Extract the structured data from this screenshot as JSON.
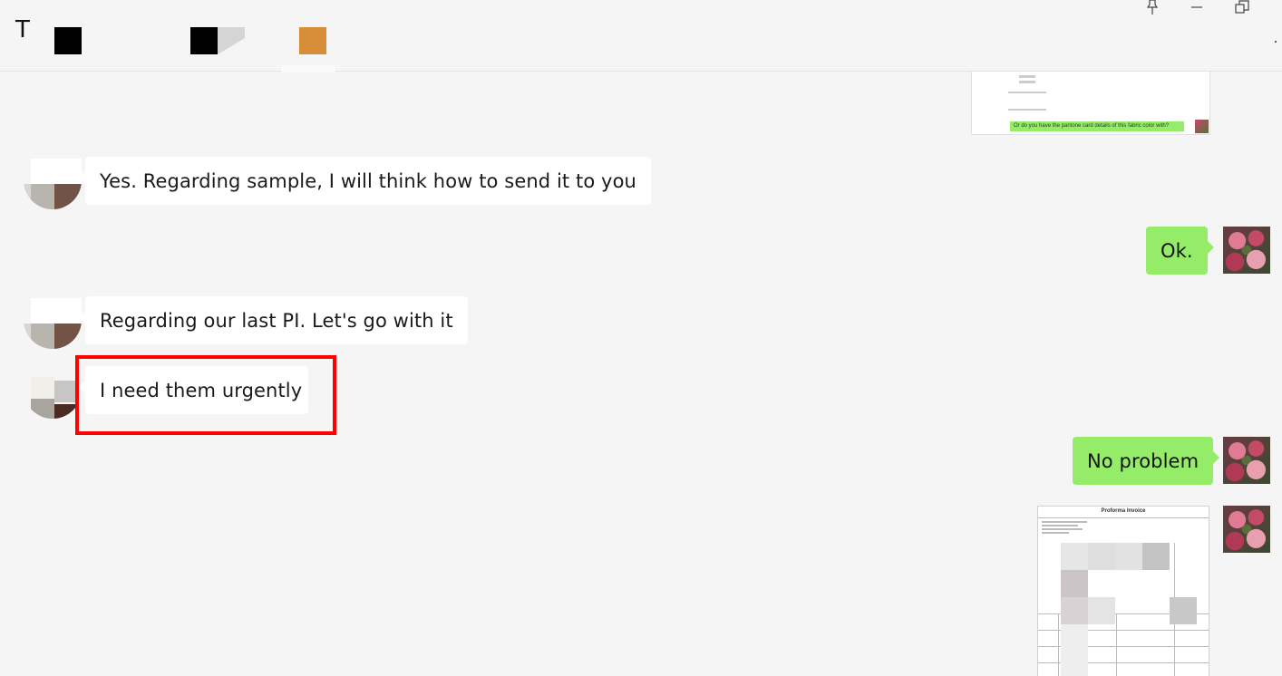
{
  "header": {
    "chat_title": "T",
    "controls": [
      "pin-icon",
      "minimize-icon",
      "restore-icon",
      "more-icon"
    ]
  },
  "messages": [
    {
      "sender": "other",
      "text": "Yes. Regarding sample, I will think how to send it to you"
    },
    {
      "sender": "self",
      "text": "Ok."
    },
    {
      "sender": "other",
      "text": "Regarding our last PI. Let's go with it"
    },
    {
      "sender": "other",
      "text": "I need them urgently",
      "highlighted": true
    },
    {
      "sender": "self",
      "text": "No problem"
    },
    {
      "sender": "self",
      "type": "image",
      "caption": "Proforma Invoice"
    }
  ],
  "thumbnail_top": {
    "green_text": "Or do you have the pantone card details of this fabric color with?"
  },
  "colors": {
    "bubble_out": "#95ec69",
    "bubble_in": "#ffffff",
    "background": "#f5f5f5",
    "highlight": "#ff0000"
  }
}
